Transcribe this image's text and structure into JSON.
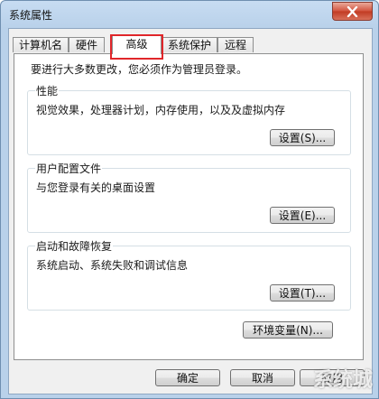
{
  "window": {
    "title": "系统属性"
  },
  "tabs": [
    {
      "label": "计算机名"
    },
    {
      "label": "硬件"
    },
    {
      "label": "高级"
    },
    {
      "label": "系统保护"
    },
    {
      "label": "远程"
    }
  ],
  "active_tab": "高级",
  "notice": "要进行大多数更改，您必须作为管理员登录。",
  "groups": {
    "performance": {
      "title": "性能",
      "desc": "视觉效果，处理器计划，内存使用，以及及虚拟内存",
      "button": "设置(S)..."
    },
    "profiles": {
      "title": "用户配置文件",
      "desc": "与您登录有关的桌面设置",
      "button": "设置(E)..."
    },
    "startup": {
      "title": "启动和故障恢复",
      "desc": "系统启动、系统失败和调试信息",
      "button": "设置(T)..."
    }
  },
  "env_button": "环境变量(N)...",
  "footer": {
    "ok": "确定",
    "cancel": "取消",
    "apply": "应用"
  },
  "watermark": "系统城",
  "colors": {
    "highlight": "#e0262a",
    "title_bar": "#b9d1ea",
    "close_button": "#c13a22"
  }
}
